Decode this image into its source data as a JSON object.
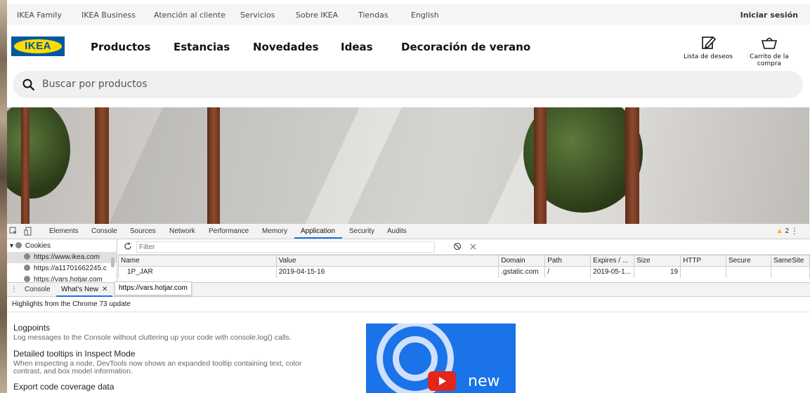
{
  "topbar": {
    "links": [
      "IKEA Family",
      "IKEA Business",
      "Atención al cliente",
      "Servicios",
      "Sobre IKEA",
      "Tiendas",
      "English"
    ],
    "login": "Iniciar sesión"
  },
  "header": {
    "logo_text": "IKEA",
    "nav": [
      "Productos",
      "Estancias",
      "Novedades",
      "Ideas",
      "Decoración de verano"
    ],
    "wishlist_label": "Lista de deseos",
    "cart_label": "Carrito de la compra"
  },
  "search": {
    "placeholder": "Buscar por productos"
  },
  "devtools": {
    "tabs": [
      "Elements",
      "Console",
      "Sources",
      "Network",
      "Performance",
      "Memory",
      "Application",
      "Security",
      "Audits"
    ],
    "active_tab": "Application",
    "warning_count": "2",
    "sidebar": {
      "section": "Cookies",
      "items": [
        "https://www.ikea.com",
        "https://a11701662245.c",
        "https://vars.hotjar.com"
      ]
    },
    "filter_placeholder": "Filter",
    "table": {
      "columns": [
        "Name",
        "Value",
        "Domain",
        "Path",
        "Expires / ...",
        "Size",
        "HTTP",
        "Secure",
        "SameSite"
      ],
      "rows": [
        [
          "1P_JAR",
          "2019-04-15-16",
          ".gstatic.com",
          "/",
          "2019-05-1...",
          "19",
          "",
          "",
          ""
        ]
      ]
    },
    "tooltip": "https://vars.hotjar.com",
    "drawer": {
      "tabs": [
        "Console",
        "What's New"
      ],
      "active_tab": "What's New",
      "subtitle": "Highlights from the Chrome 73 update",
      "features": [
        {
          "title": "Logpoints",
          "desc": "Log messages to the Console without cluttering up your code with console.log() calls."
        },
        {
          "title": "Detailed tooltips in Inspect Mode",
          "desc": "When inspecting a node, DevTools now shows an expanded tooltip containing text, color contrast, and box model information."
        },
        {
          "title": "Export code coverage data",
          "desc": ""
        }
      ],
      "video_label": "new"
    }
  },
  "colors": {
    "ikea_blue": "#0058a3",
    "ikea_yellow": "#ffdb00",
    "devtools_accent": "#1a73e8"
  }
}
